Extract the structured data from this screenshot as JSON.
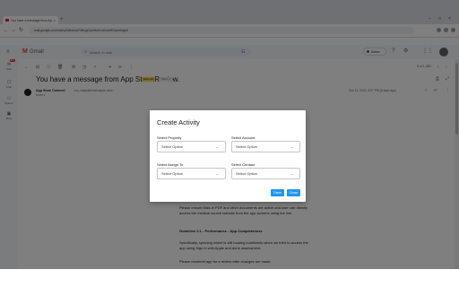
{
  "browser": {
    "tab_title": "You have a message from App",
    "tab_close": "×",
    "new_tab": "+",
    "url": "mail.google.com/mail/u/0/#inbox/FMfcgzGwHbnCcdXxfnHGzsmGqjs9",
    "nav_back": "←",
    "nav_forward": "→",
    "nav_reload": "↻",
    "win_min": "–",
    "win_max": "□",
    "win_close": "×"
  },
  "gmail": {
    "menu_glyph": "≡",
    "logo_letter": "M",
    "app_name": "Gmail",
    "search_glyph": "⌕",
    "search_placeholder": "Search in mail",
    "filter_glyph": "☷",
    "status_label": "Active",
    "help_glyph": "?",
    "settings_glyph": "⚙",
    "apps_glyph": "⋮⋮"
  },
  "leftnav": {
    "mail_label": "Mail",
    "mail_badge": "99+",
    "chat_label": "Chat",
    "spaces_label": "Spaces",
    "meet_label": "Meet"
  },
  "toolbar": {
    "back_glyph": "←",
    "archive_glyph": "⊟",
    "spam_glyph": "ⓘ",
    "delete_glyph": "🗑",
    "mark_glyph": "✉",
    "snooze_glyph": "◷",
    "task_glyph": "✓",
    "move_glyph": "⇥",
    "label_glyph": "⊳",
    "more_glyph": "⋮",
    "pager": "8 of 1,480",
    "prev_glyph": "‹",
    "next_glyph": "›"
  },
  "message": {
    "subject": "You have a message from App Store Review.",
    "label_external": "External",
    "label_inbox": "Inbox ×",
    "print_glyph": "⎙",
    "open_glyph": "⤢",
    "sender_name": "App Store Connect",
    "sender_email": "<no_reply@email.apple.com>",
    "to_line": "to me ▾",
    "date": "Sun 10, 2021, 5:07 PM (6 days ago)",
    "star_glyph": "☆",
    "reply_glyph": "↩",
    "more_glyph": "⋮",
    "body_para1": "Please ensure links in PDF and other documents are active and user can directly access the medical source website from the app screens using the link.",
    "body_heading": "Guideline 2.1 - Performance - App Completeness",
    "body_para2": "Specifically, spinning wheel is still loading indefinitely when we tried to access the app using Sign in with Apple and done assessment.",
    "body_para3": "Please resubmit app for a review after changes are made."
  },
  "dialog": {
    "title": "Create Activity",
    "property_label": "Select Property",
    "property_value": "Select Option",
    "account_label": "Select Account",
    "account_value": "Select Option",
    "assign_label": "Select Assign To",
    "assign_value": "Select Option",
    "contact_label": "Select Contact",
    "contact_value": "Select Option",
    "chevron_glyph": "⌄",
    "save_label": "Save",
    "close_label": "Close"
  },
  "colors": {
    "accent": "#2196f3",
    "overlay": "#000000",
    "gmail_red": "#ea4335"
  }
}
